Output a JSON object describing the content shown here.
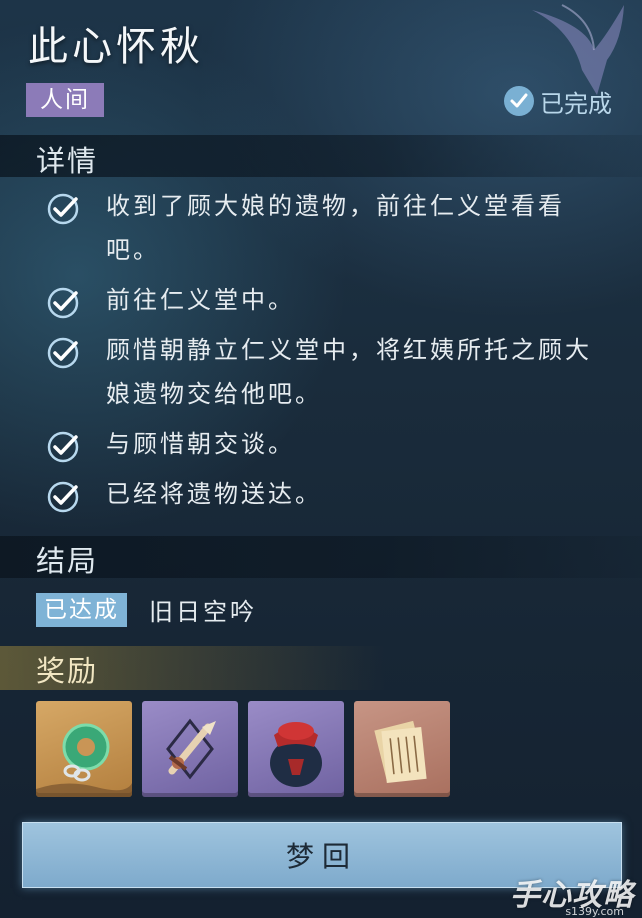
{
  "quest": {
    "title": "此心怀秋",
    "category_tag": "人间",
    "status": "已完成"
  },
  "details": {
    "heading": "详情",
    "tasks": [
      {
        "text": "收到了顾大娘的遗物，前往仁义堂看看吧。",
        "done": true
      },
      {
        "text": "前往仁义堂中。",
        "done": true
      },
      {
        "text": "顾惜朝静立仁义堂中，将红姨所托之顾大娘遗物交给他吧。",
        "done": true
      },
      {
        "text": "与顾惜朝交谈。",
        "done": true
      },
      {
        "text": "已经将遗物送达。",
        "done": true
      }
    ]
  },
  "ending": {
    "heading": "结局",
    "badge": "已达成",
    "name": "旧日空吟"
  },
  "rewards": {
    "heading": "奖励",
    "items": [
      {
        "icon": "jade-pendant-icon",
        "rarity_color": "#c99556"
      },
      {
        "icon": "dagger-icon",
        "rarity_color": "#8577b6"
      },
      {
        "icon": "wine-jar-icon",
        "rarity_color": "#8577b6"
      },
      {
        "icon": "book-scroll-icon",
        "rarity_color": "#b9806e"
      }
    ]
  },
  "actions": {
    "dream_label": "梦回"
  },
  "watermark": {
    "text": "手心攻略",
    "sub": "s139y.com"
  },
  "colors": {
    "tag_bg": "#8c7bb8",
    "accent_blue": "#7fb3d6",
    "reward_gold": "#968240"
  }
}
